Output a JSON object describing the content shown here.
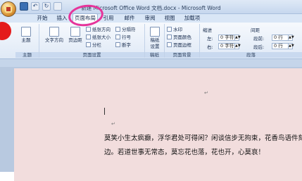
{
  "window": {
    "title": "新建 Microsoft Office Word 文档.docx - Microsoft Word"
  },
  "tabs": [
    "开始",
    "插入",
    "页面布局",
    "引用",
    "邮件",
    "审阅",
    "视图",
    "加载项"
  ],
  "active_tab": "页面布局",
  "ribbon": {
    "themes": {
      "label": "主题",
      "btn": "主题"
    },
    "page_setup": {
      "label": "页面设置",
      "text_direction": "文字方向",
      "margins": "页边距",
      "orientation": "纸张方向",
      "size": "纸张大小",
      "columns": "分栏",
      "breaks": "分隔符",
      "line_numbers": "行号",
      "hyphenation": "断字"
    },
    "draft": {
      "label": "稿纸",
      "btn1": "稿纸",
      "btn2": "设置"
    },
    "page_bg": {
      "label": "页面背景",
      "watermark": "水印",
      "color": "页面颜色",
      "borders": "页面边框"
    },
    "paragraph": {
      "label": "段落",
      "indent": "缩进",
      "spacing": "间距",
      "left": "左:",
      "right": "右:",
      "before": "段前:",
      "after": "段后:",
      "left_value": "0 字符",
      "right_value": "0 字符",
      "before_value": "0 行",
      "after_value": "0 行"
    }
  },
  "document": {
    "line1": "莫笑小生太疯癫，浮华君处可得闲？闲谈信步无拘束，花香鸟语件刻",
    "line2": "边。若道世事无常态，莫忘花也落，花也开，心莫哀！"
  }
}
